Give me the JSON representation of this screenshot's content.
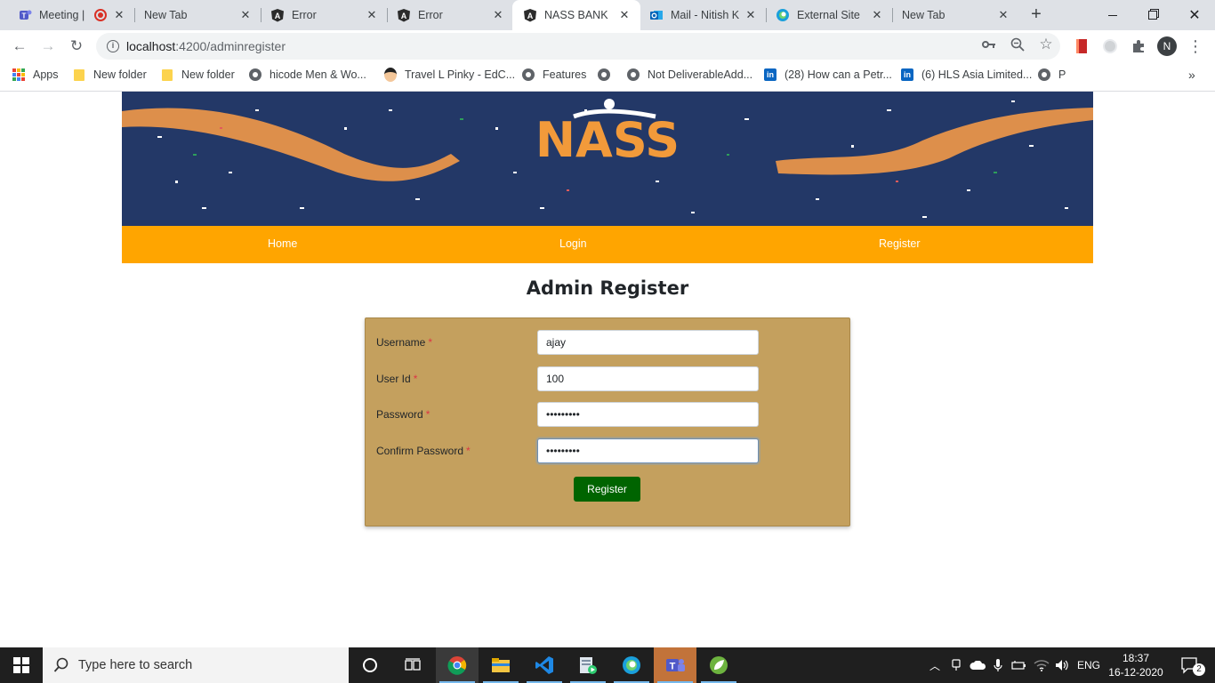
{
  "browser": {
    "tabs": [
      {
        "title": "Meeting |",
        "icon": "teams-icon"
      },
      {
        "title": "New Tab",
        "icon": ""
      },
      {
        "title": "Error",
        "icon": "angular-icon"
      },
      {
        "title": "Error",
        "icon": "angular-icon"
      },
      {
        "title": "NASS BANK",
        "icon": "angular-icon",
        "active": true
      },
      {
        "title": "Mail - Nitish K",
        "icon": "outlook-icon"
      },
      {
        "title": "External Site",
        "icon": "edge-icon"
      },
      {
        "title": "New Tab",
        "icon": ""
      }
    ],
    "new_tab_symbol": "+",
    "address": {
      "host": "localhost",
      "rest": ":4200/adminregister"
    },
    "profile_initial": "N",
    "bookmarks": [
      {
        "label": "Apps",
        "icon": "apps-grid-icon"
      },
      {
        "label": "New folder",
        "icon": "folder-icon"
      },
      {
        "label": "New folder",
        "icon": "folder-icon"
      },
      {
        "label": "hicode Men & Wo...",
        "icon": "globe-icon"
      },
      {
        "label": "Travel L Pinky - EdC...",
        "icon": "avatar-icon"
      },
      {
        "label": "Features",
        "icon": "globe-icon"
      },
      {
        "label": "",
        "icon": "globe-icon"
      },
      {
        "label": "Not DeliverableAdd...",
        "icon": "globe-icon"
      },
      {
        "label": "(28) How can a Petr...",
        "icon": "linkedin-icon"
      },
      {
        "label": "(6) HLS Asia Limited...",
        "icon": "linkedin-icon"
      },
      {
        "label": "P",
        "icon": "globe-icon"
      }
    ]
  },
  "site": {
    "logo_text": "NASS",
    "nav": {
      "home": "Home",
      "login": "Login",
      "register": "Register"
    },
    "page_title": "Admin Register",
    "form": {
      "username": {
        "label": "Username",
        "value": "ajay"
      },
      "userid": {
        "label": "User Id",
        "value": "100"
      },
      "password": {
        "label": "Password",
        "value": "•••••••••"
      },
      "confirm": {
        "label": "Confirm Password",
        "value": "•••••••••"
      },
      "required_mark": "*",
      "submit_label": "Register"
    }
  },
  "taskbar": {
    "search_placeholder": "Type here to search",
    "language": "ENG",
    "time": "18:37",
    "date": "16-12-2020",
    "notification_count": "2"
  },
  "colors": {
    "banner_bg": "#233867",
    "navbar": "#ffa500",
    "card": "#c4a05e",
    "button": "#006400"
  }
}
